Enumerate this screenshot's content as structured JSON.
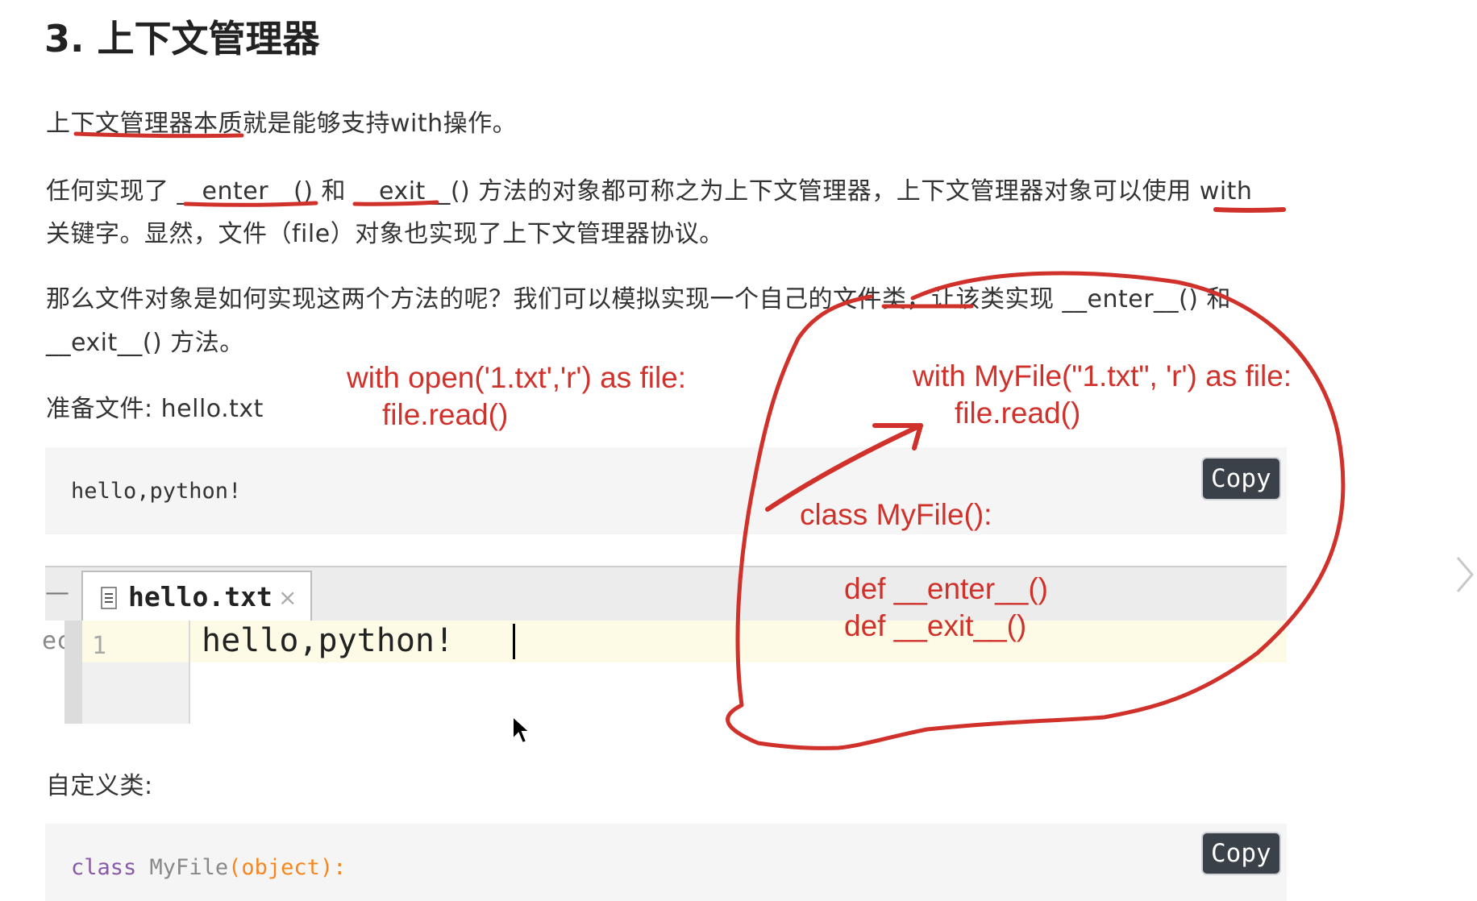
{
  "heading": "3. 上下文管理器",
  "para1": "上下文管理器本质就是能够支持with操作。",
  "para2_line1": "任何实现了 __enter__() 和 __exit__() 方法的对象都可称之为上下文管理器，上下文管理器对象可以使用 with",
  "para2_line2": "关键字。显然，文件（file）对象也实现了上下文管理器协议。",
  "para3_line1": "那么文件对象是如何实现这两个方法的呢？我们可以模拟实现一个自己的文件类，让该类实现 __enter__() 和",
  "para3_line2": "__exit__() 方法。",
  "prepare_label": "准备文件: hello.txt",
  "code_block1": {
    "content": "hello,python!",
    "copy_label": "Copy"
  },
  "editor": {
    "tab_label": "hello.txt",
    "tab_close": "×",
    "collapse_symbol": "—",
    "side_text": "ect",
    "line_number": "1",
    "line_content": "hello,python!"
  },
  "custom_class_label": "自定义类:",
  "code_block2": {
    "keyword": "class",
    "name": "MyFile",
    "open": "(",
    "arg": "object",
    "close": "):",
    "copy_label": "Copy"
  },
  "annotations": {
    "line1": "with open('1.txt','r') as file:",
    "line2": "file.read()",
    "line3": "with MyFile(\"1.txt\", 'r') as file:",
    "line4": "file.read()",
    "line5": "class MyFile():",
    "line6": "def __enter__()",
    "line7": "def __exit__()"
  },
  "colors": {
    "annotation": "#d0312b",
    "copy_button": "#3a4149",
    "code_bg": "#f5f5f5",
    "editor_line_highlight": "#fdfbe5",
    "keyword": "#8959a8",
    "builtin": "#f5871f"
  }
}
